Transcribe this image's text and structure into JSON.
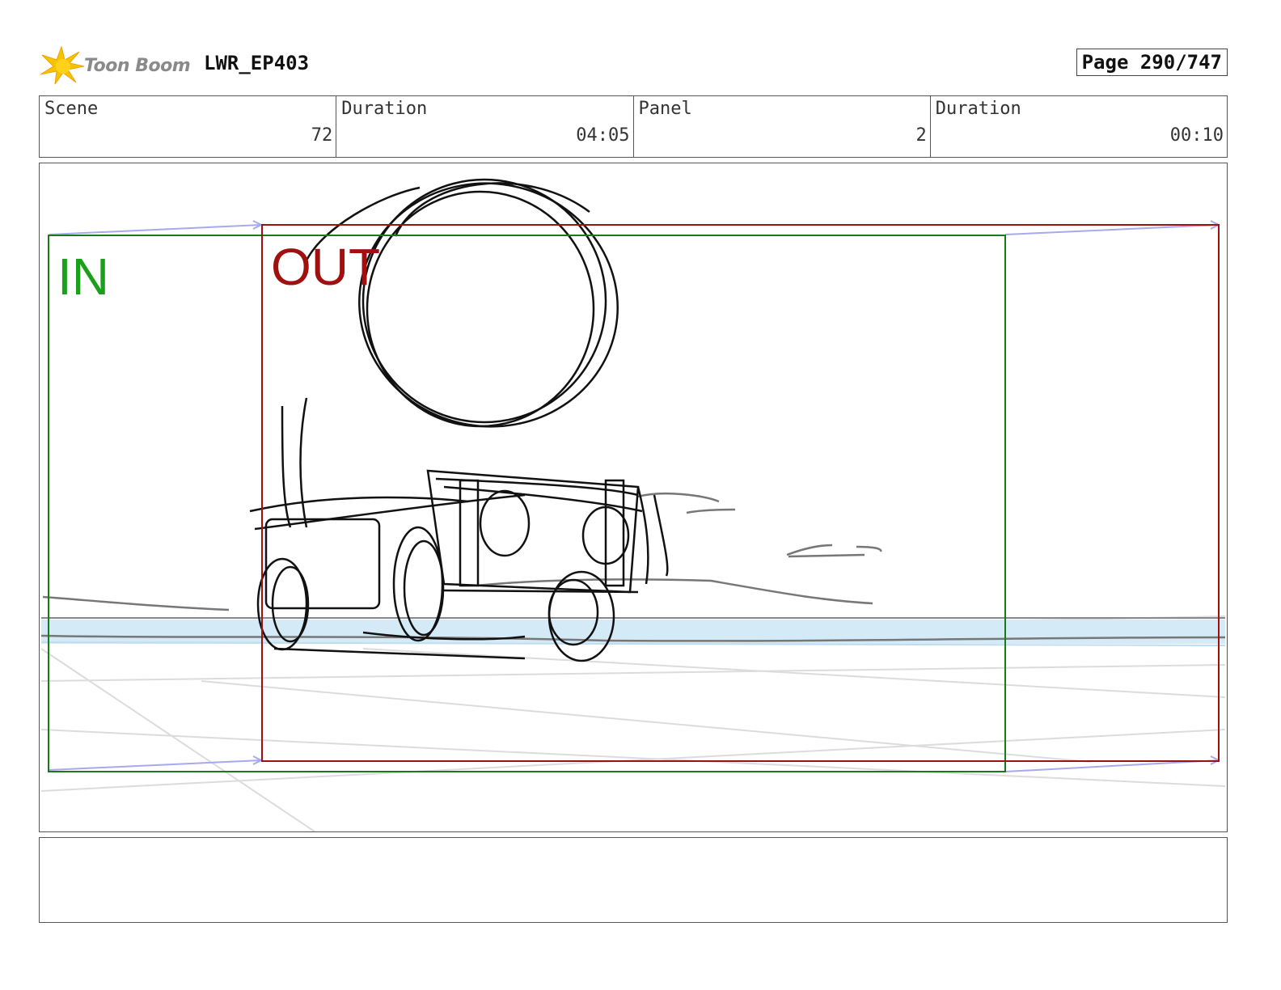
{
  "header": {
    "logo_text": "Toon Boom",
    "project_title": "LWR_EP403",
    "page_label": "Page 290/747"
  },
  "info": [
    {
      "label": "Scene",
      "value": "72"
    },
    {
      "label": "Duration",
      "value": "04:05"
    },
    {
      "label": "Panel",
      "value": "2"
    },
    {
      "label": "Duration",
      "value": "00:10"
    }
  ],
  "panel": {
    "in_label": "IN",
    "out_label": "OUT",
    "in_color": "#1a8a1a",
    "out_color": "#a01010"
  },
  "notes": {
    "text": ""
  }
}
